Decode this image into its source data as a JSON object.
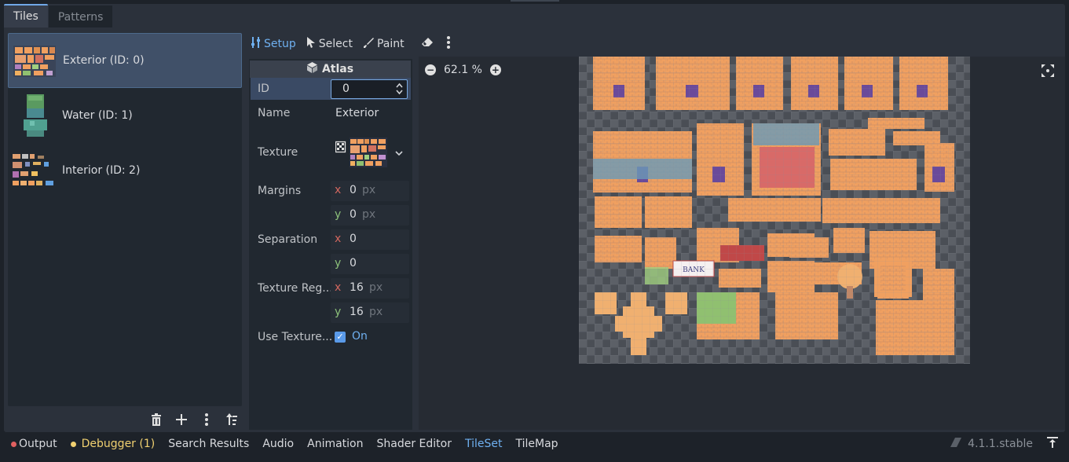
{
  "tabs": [
    {
      "label": "Tiles",
      "active": true
    },
    {
      "label": "Patterns",
      "active": false
    }
  ],
  "sources": [
    {
      "label": "Exterior (ID: 0)",
      "selected": true
    },
    {
      "label": "Water (ID: 1)",
      "selected": false
    },
    {
      "label": "Interior (ID: 2)",
      "selected": false
    }
  ],
  "source_toolbar": {
    "icons": [
      "trash-icon",
      "plus-icon",
      "kebab-menu-icon",
      "sort-icon"
    ]
  },
  "modes": {
    "setup": "Setup",
    "select": "Select",
    "paint": "Paint",
    "icons": [
      "setup-icon",
      "select-cursor-icon",
      "paint-brush-icon",
      "eraser-icon",
      "kebab-menu-icon"
    ]
  },
  "inspector": {
    "header": "Atlas",
    "id_label": "ID",
    "id_value": "0",
    "name_label": "Name",
    "name_value": "Exterior",
    "texture_label": "Texture",
    "margins_label": "Margins",
    "margins": {
      "x": "0",
      "y": "0",
      "unit": "px"
    },
    "separation_label": "Separation",
    "separation": {
      "x": "0",
      "y": "0"
    },
    "texture_region_label": "Texture Reg...",
    "texture_region": {
      "x": "16",
      "y": "16",
      "unit": "px"
    },
    "use_texture_label": "Use Texture...",
    "use_texture_value": "On",
    "axis_x": "x",
    "axis_y": "y"
  },
  "atlas_view": {
    "zoom": "62.1 %"
  },
  "bottom_bar": {
    "items": [
      "Output",
      "Debugger (1)",
      "Search Results",
      "Audio",
      "Animation",
      "Shader Editor",
      "TileSet",
      "TileMap"
    ],
    "active": "TileSet",
    "version": "4.1.1.stable"
  },
  "colors": {
    "accent": "#6fb0f0",
    "output_dot": "#e06060",
    "debugger_dot": "#f0d070",
    "tile_orange": "#f0a060"
  }
}
